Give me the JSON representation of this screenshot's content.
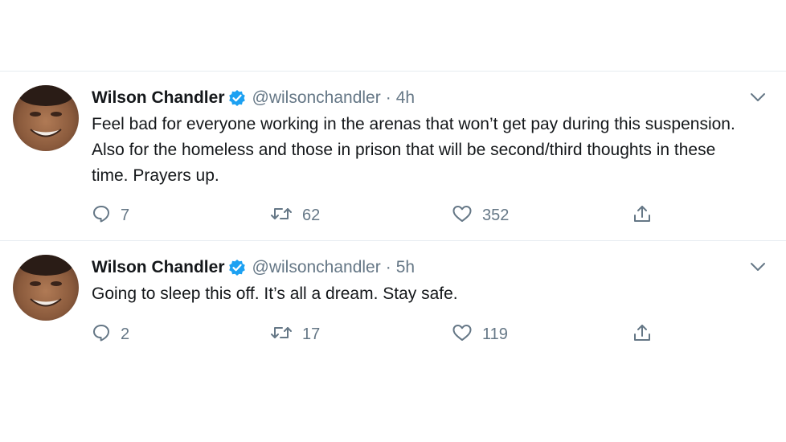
{
  "tweets": [
    {
      "name": "Wilson Chandler",
      "handle": "@wilsonchandler",
      "separator": "·",
      "time": "4h",
      "text": "Feel bad for everyone working in the arenas that won’t get pay during this suspension. Also for the homeless and those in prison that will be second/third thoughts in these time. Prayers up.",
      "replies": "7",
      "retweets": "62",
      "likes": "352"
    },
    {
      "name": "Wilson Chandler",
      "handle": "@wilsonchandler",
      "separator": "·",
      "time": "5h",
      "text": "Going to sleep this off. It’s all a dream. Stay safe.",
      "replies": "2",
      "retweets": "17",
      "likes": "119"
    }
  ],
  "icons": {
    "verified": "verified-badge-icon",
    "caret": "chevron-down-icon",
    "reply": "reply-bubble-icon",
    "retweet": "retweet-icon",
    "like": "heart-icon",
    "share": "share-upload-icon"
  },
  "colors": {
    "accent": "#1da1f2",
    "muted": "#657786",
    "text": "#14171a",
    "divider": "#e6ecf0"
  }
}
